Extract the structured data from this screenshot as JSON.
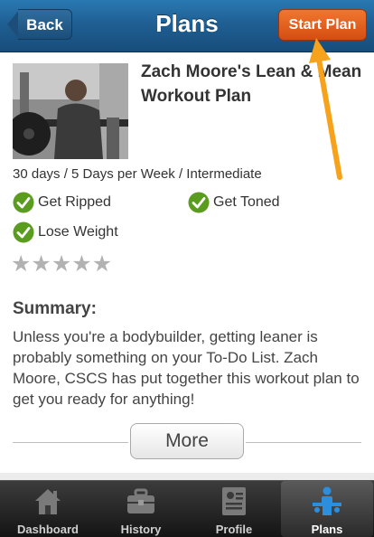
{
  "header": {
    "title": "Plans",
    "back_label": "Back",
    "start_plan_label": "Start Plan"
  },
  "plan": {
    "title": "Zach Moore's Lean & Mean Workout Plan",
    "meta": "30 days / 5 Days per Week / Intermediate",
    "goals": [
      {
        "label": "Get Ripped",
        "icon": "check-icon"
      },
      {
        "label": "Get Toned",
        "icon": "check-icon"
      },
      {
        "label": "Lose Weight",
        "icon": "check-icon"
      }
    ],
    "rating": {
      "filled": 0,
      "max": 5
    },
    "summary_heading": "Summary:",
    "summary_text": "Unless you're a bodybuilder, getting leaner is probably something on your To-Do List. Zach Moore, CSCS has put together this workout plan to get you ready for anything!",
    "more_label": "More"
  },
  "tabs": [
    {
      "label": "Dashboard",
      "icon": "house-icon",
      "active": false
    },
    {
      "label": "History",
      "icon": "briefcase-icon",
      "active": false
    },
    {
      "label": "Profile",
      "icon": "profile-card-icon",
      "active": false
    },
    {
      "label": "Plans",
      "icon": "people-icon",
      "active": true
    }
  ],
  "colors": {
    "header_blue": "#1f5f93",
    "start_orange": "#e0601d",
    "check_green": "#5a9c1e",
    "active_tab_icon": "#2c8fde",
    "annotation_arrow": "#f7a21b"
  }
}
